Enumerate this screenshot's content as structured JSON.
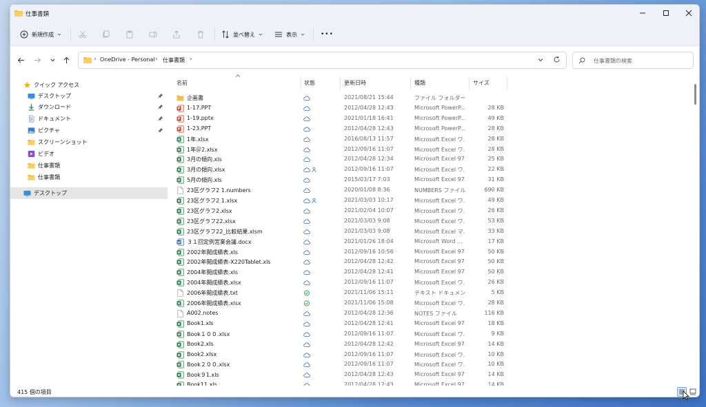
{
  "window": {
    "title": "仕事書類"
  },
  "toolbar": {
    "new_label": "新規作成",
    "sort_label": "並べ替え",
    "view_label": "表示",
    "more_label": "•••"
  },
  "address": {
    "crumbs": [
      "OneDrive - Personal",
      "仕事書類"
    ]
  },
  "search": {
    "placeholder": "仕事書類の検索"
  },
  "sidebar": {
    "items": [
      {
        "label": "クイック アクセス",
        "icon": "star-icon",
        "pinned": false
      },
      {
        "label": "デスクトップ",
        "icon": "desktop-icon",
        "pinned": true
      },
      {
        "label": "ダウンロード",
        "icon": "download-icon",
        "pinned": true
      },
      {
        "label": "ドキュメント",
        "icon": "document-icon",
        "pinned": true
      },
      {
        "label": "ピクチャ",
        "icon": "picture-icon",
        "pinned": true
      },
      {
        "label": "スクリーンショット",
        "icon": "folder-icon",
        "pinned": false
      },
      {
        "label": "ビデオ",
        "icon": "video-icon",
        "pinned": false
      },
      {
        "label": "仕事書類",
        "icon": "folder-icon",
        "pinned": false
      },
      {
        "label": "仕事書類",
        "icon": "folder-icon",
        "pinned": false
      },
      {
        "label": "デスクトップ",
        "icon": "desktop-icon",
        "pinned": false,
        "selected": true
      }
    ]
  },
  "columns": {
    "name": "名前",
    "status": "状態",
    "modified": "更新日時",
    "type": "種類",
    "size": "サイズ"
  },
  "files": [
    {
      "name": "企画書",
      "kind": "folder",
      "date": "2021/08/21 15:44",
      "type": "ファイル フォルダー",
      "size": "",
      "status": "cloud"
    },
    {
      "name": "1-17.PPT",
      "kind": "ppt",
      "date": "2012/04/28 12:43",
      "type": "Microsoft PowerP...",
      "size": "28 KB",
      "status": "cloud"
    },
    {
      "name": "1-19.pptx",
      "kind": "ppt",
      "date": "2021/01/18 16:41",
      "type": "Microsoft PowerP...",
      "size": "49 KB",
      "status": "cloud"
    },
    {
      "name": "1-23.PPT",
      "kind": "ppt",
      "date": "2012/04/28 12:43",
      "type": "Microsoft PowerP...",
      "size": "28 KB",
      "status": "cloud"
    },
    {
      "name": "1年.xlsx",
      "kind": "xls",
      "date": "2016/08/13 11:57",
      "type": "Microsoft Excel ワ...",
      "size": "28 KB",
      "status": "cloud"
    },
    {
      "name": "1年＠2.xlsx",
      "kind": "xls",
      "date": "2012/09/16 11:07",
      "type": "Microsoft Excel ワ...",
      "size": "28 KB",
      "status": "cloud"
    },
    {
      "name": "3月の傾向.xls",
      "kind": "xls",
      "date": "2012/04/28 12:34",
      "type": "Microsoft Excel 97...",
      "size": "25 KB",
      "status": "cloud"
    },
    {
      "name": "3月の傾向.xlsx",
      "kind": "xls",
      "date": "2012/09/16 11:07",
      "type": "Microsoft Excel ワ...",
      "size": "22 KB",
      "status": "cloud-shared"
    },
    {
      "name": "5月の傾向.xls",
      "kind": "xls",
      "date": "2015/03/17 7:03",
      "type": "Microsoft Excel 97...",
      "size": "31 KB",
      "status": "cloud"
    },
    {
      "name": "23区グラフ2 1.numbers",
      "kind": "generic",
      "date": "2020/01/08 8:36",
      "type": "NUMBERS ファイル",
      "size": "690 KB",
      "status": "cloud"
    },
    {
      "name": "23区グラフ2 1.xlsx",
      "kind": "xls",
      "date": "2021/03/03 10:17",
      "type": "Microsoft Excel ワ...",
      "size": "49 KB",
      "status": "cloud-shared"
    },
    {
      "name": "23区グラフ2.xlsx",
      "kind": "xls",
      "date": "2021/02/04 10:07",
      "type": "Microsoft Excel ワ...",
      "size": "26 KB",
      "status": "cloud"
    },
    {
      "name": "23区グラフ22.xlsx",
      "kind": "xls",
      "date": "2021/03/03 9:08",
      "type": "Microsoft Excel ワ...",
      "size": "53 KB",
      "status": "cloud"
    },
    {
      "name": "23区グラフ22_比較結果.xlsm",
      "kind": "xls",
      "date": "2021/03/03 9:08",
      "type": "Microsoft Excel マ...",
      "size": "33 KB",
      "status": "cloud"
    },
    {
      "name": "３１回定例営業会議.docx",
      "kind": "doc",
      "date": "2021/01/26 18:04",
      "type": "Microsoft Word ...",
      "size": "17 KB",
      "status": "cloud"
    },
    {
      "name": "2002年閲成績表.xls",
      "kind": "xls",
      "date": "2012/09/16 10:56",
      "type": "Microsoft Excel 97...",
      "size": "50 KB",
      "status": "cloud"
    },
    {
      "name": "2002年閲成績表-X220Tablet.xls",
      "kind": "xls",
      "date": "2012/04/28 12:42",
      "type": "Microsoft Excel 97...",
      "size": "50 KB",
      "status": "cloud"
    },
    {
      "name": "2004年閲成績表.xls",
      "kind": "xls",
      "date": "2012/04/28 12:41",
      "type": "Microsoft Excel 97...",
      "size": "50 KB",
      "status": "cloud"
    },
    {
      "name": "2004年閲成績表.xlsx",
      "kind": "xls",
      "date": "2012/09/16 11:07",
      "type": "Microsoft Excel ワ...",
      "size": "26 KB",
      "status": "cloud"
    },
    {
      "name": "2006年閲成績表.txt",
      "kind": "generic",
      "date": "2021/11/06 15:11",
      "type": "テキスト ドキュメント",
      "size": "5 KB",
      "status": "synced"
    },
    {
      "name": "2006年閲成績表.xlsx",
      "kind": "xls",
      "date": "2021/11/06 15:08",
      "type": "Microsoft Excel ワ...",
      "size": "28 KB",
      "status": "synced"
    },
    {
      "name": "A002.notes",
      "kind": "generic",
      "date": "2012/04/28 12:36",
      "type": "NOTES ファイル",
      "size": "116 KB",
      "status": "cloud"
    },
    {
      "name": "Book1.xls",
      "kind": "xls",
      "date": "2012/04/28 12:41",
      "type": "Microsoft Excel 97...",
      "size": "18 KB",
      "status": "cloud"
    },
    {
      "name": "Book１００.xlsx",
      "kind": "xls",
      "date": "2012/09/16 11:07",
      "type": "Microsoft Excel ワ...",
      "size": "9 KB",
      "status": "cloud"
    },
    {
      "name": "Book2.xls",
      "kind": "xls",
      "date": "2012/04/28 12:42",
      "type": "Microsoft Excel 97...",
      "size": "14 KB",
      "status": "cloud"
    },
    {
      "name": "Book2.xlsx",
      "kind": "xls",
      "date": "2012/09/16 11:07",
      "type": "Microsoft Excel ワ...",
      "size": "10 KB",
      "status": "cloud"
    },
    {
      "name": "Book２００.xlsx",
      "kind": "xls",
      "date": "2012/09/16 11:07",
      "type": "Microsoft Excel ワ...",
      "size": "10 KB",
      "status": "cloud"
    },
    {
      "name": "Book９1.xls",
      "kind": "xls",
      "date": "2012/04/28 12:43",
      "type": "Microsoft Excel 97...",
      "size": "14 KB",
      "status": "cloud"
    },
    {
      "name": "Book11.xls",
      "kind": "xls",
      "date": "2012/04/28 12:43",
      "type": "Microsoft Excel 97...",
      "size": "14 KB",
      "status": "cloud"
    }
  ],
  "status": {
    "item_count": "415 個の項目"
  },
  "colors": {
    "accent": "#0067c0",
    "cloud": "#2b6cb8",
    "synced": "#2e9e48",
    "excel": "#1d7044",
    "ppt": "#c43e1c",
    "word": "#2b579a",
    "folder": "#f4c04c"
  }
}
